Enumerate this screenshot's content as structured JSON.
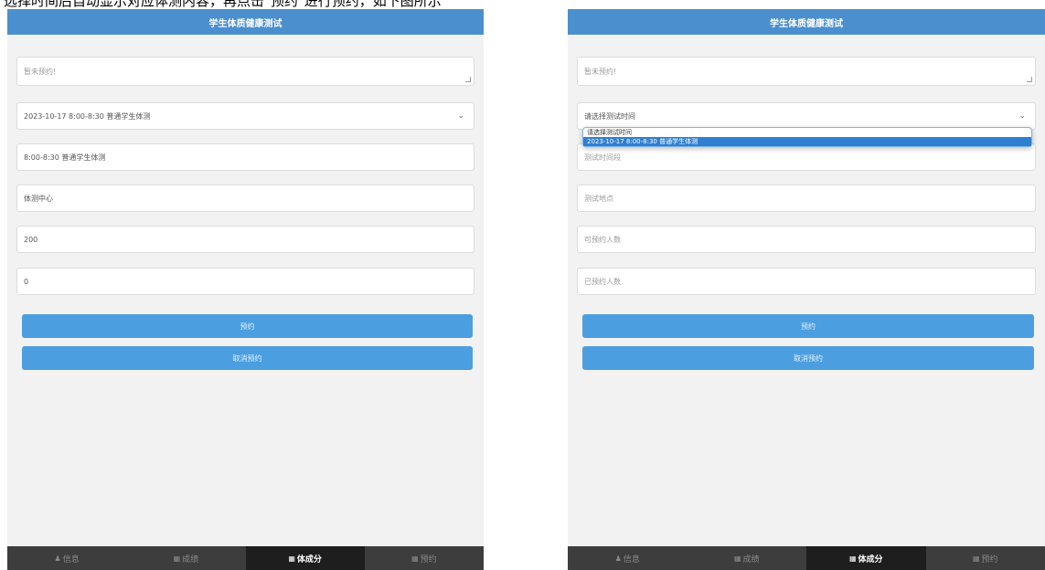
{
  "caption": "选择时间后自动显示对应体测内容，再点击\"预约\"进行预约，如下图所示",
  "colors": {
    "header": "#4b8fcf",
    "button": "#4b9ee0",
    "tabbar": "#3d3d3d",
    "selected_option": "#2f7fd0"
  },
  "left": {
    "header_title": "学生体质健康测试",
    "notice_placeholder": "暂未预约!",
    "time_select_value": "2023-10-17 8:00-8:30 普通学生体测",
    "time_field": "8:00-8:30 普通学生体测",
    "location_field": "体测中心",
    "capacity_field": "200",
    "booked_field": "0",
    "reserve_button": "预约",
    "cancel_button": "取消预约"
  },
  "right": {
    "header_title": "学生体质健康测试",
    "notice_placeholder": "暂未预约!",
    "time_select_placeholder": "请选择测试时间",
    "dropdown_options": [
      "请选择测试时间",
      "2023-10-17 8:00-8:30 普通学生体测"
    ],
    "time_placeholder": "测试时间段",
    "location_placeholder": "测试地点",
    "capacity_placeholder": "可预约人数",
    "booked_placeholder": "已预约人数",
    "reserve_button": "预约",
    "cancel_button": "取消预约"
  },
  "tabs": [
    {
      "icon": "user-icon",
      "glyph": "♟",
      "label": "信息"
    },
    {
      "icon": "grid-icon",
      "glyph": "▦",
      "label": "成绩"
    },
    {
      "icon": "grid-icon",
      "glyph": "▦",
      "label": "体成分"
    },
    {
      "icon": "grid-icon",
      "glyph": "▦",
      "label": "预约"
    }
  ]
}
